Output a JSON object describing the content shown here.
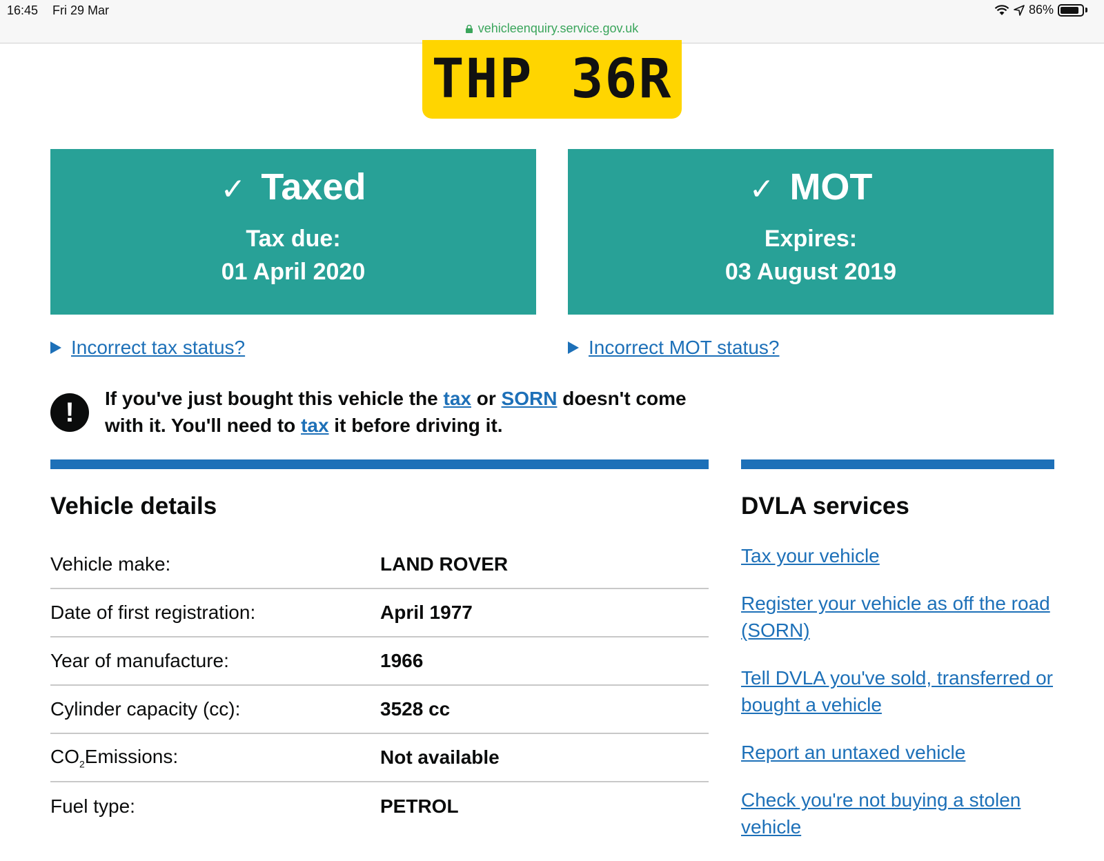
{
  "status_bar": {
    "time": "16:45",
    "date": "Fri 29 Mar",
    "battery": "86%",
    "battery_level": 0.86,
    "url": "vehicleenquiry.service.gov.uk"
  },
  "plate": {
    "registration": "THP 36R"
  },
  "tax_panel": {
    "check": "✓",
    "title": "Taxed",
    "label": "Tax due:",
    "date": "01 April 2020"
  },
  "mot_panel": {
    "check": "✓",
    "title": "MOT",
    "label": "Expires:",
    "date": "03 August 2019"
  },
  "links": {
    "incorrect_tax": "Incorrect tax status?",
    "incorrect_mot": "Incorrect MOT status?"
  },
  "warning": {
    "icon": "!",
    "part1": "If you've just bought this vehicle the ",
    "tax_link": "tax",
    "part2": " or ",
    "sorn_link": "SORN",
    "part3": " doesn't come with it. You'll need to ",
    "tax_link2": "tax",
    "part4": " it before driving it."
  },
  "vehicle_details": {
    "heading": "Vehicle details",
    "rows": [
      {
        "label": "Vehicle make:",
        "value": "LAND ROVER"
      },
      {
        "label": "Date of first registration:",
        "value": "April 1977"
      },
      {
        "label": "Year of manufacture:",
        "value": "1966"
      },
      {
        "label": "Cylinder capacity (cc):",
        "value": "3528 cc"
      },
      {
        "label_pre": "CO",
        "label_sub": "2",
        "label_post": "Emissions:",
        "value": "Not available"
      },
      {
        "label": "Fuel type:",
        "value": "PETROL"
      }
    ]
  },
  "dvla_services": {
    "heading": "DVLA services",
    "items": [
      "Tax your vehicle",
      "Register your vehicle as off the road (SORN)",
      "Tell DVLA you've sold, transferred or bought a vehicle",
      "Report an untaxed vehicle",
      "Check you're not buying a stolen vehicle"
    ]
  },
  "colors": {
    "status_green": "#28a197",
    "link_blue": "#1d70b8",
    "plate_yellow": "#ffd500",
    "url_green": "#3aa55b"
  }
}
